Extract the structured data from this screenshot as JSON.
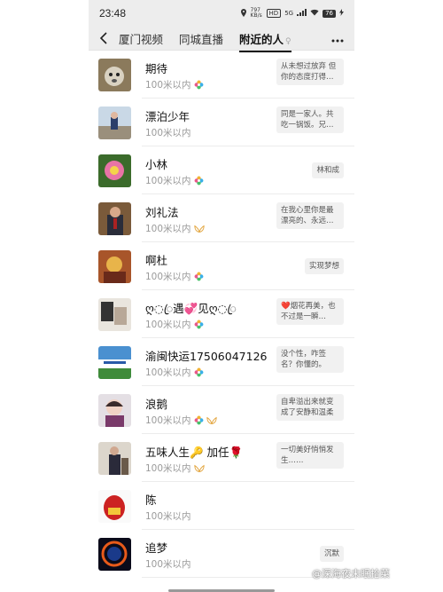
{
  "status": {
    "time": "23:48",
    "net_speed": "797 KB/s",
    "hd": "HD",
    "signal": "5G",
    "battery": "76"
  },
  "nav": {
    "tabs": [
      "厦门视频",
      "同城直播",
      "附近的人"
    ],
    "active_tab": 2,
    "filter_hint": "♀"
  },
  "users": [
    {
      "name": "期待",
      "distance": "100米以内",
      "badges": [
        "flower"
      ],
      "signature": "从未想过放弃 但你的态度打得…"
    },
    {
      "name": "漂泊少年",
      "distance": "100米以内",
      "badges": [],
      "signature": "同是一家人。共吃一锅饭。兄…"
    },
    {
      "name": "小林",
      "distance": "100米以内",
      "badges": [
        "flower"
      ],
      "signature": "林和成"
    },
    {
      "name": "刘礼法",
      "distance": "100米以内",
      "badges": [
        "wings"
      ],
      "signature": "在我心里你是最漂亮的、永远…"
    },
    {
      "name": "啊杜",
      "distance": "100米以内",
      "badges": [
        "flower"
      ],
      "signature": "实现梦想"
    },
    {
      "name": "ღ◌ꦿ遇💞见ღ◌ꦿ",
      "distance": "100米以内",
      "badges": [
        "flower"
      ],
      "signature": "❤️烟花再美，也不过是一瞬…"
    },
    {
      "name": "渝闽快运17506047126",
      "distance": "100米以内",
      "badges": [
        "flower"
      ],
      "signature": "没个性，咋签名？你懂的。"
    },
    {
      "name": "浪鹅",
      "distance": "100米以内",
      "badges": [
        "flower",
        "wings"
      ],
      "signature": "自卑溢出来就变成了安静和温柔"
    },
    {
      "name": "五味人生🔑 加任🌹",
      "distance": "100米以内",
      "badges": [
        "wings"
      ],
      "signature": "一切美好悄悄发生……"
    },
    {
      "name": "陈",
      "distance": "100米以内",
      "badges": [],
      "signature": ""
    },
    {
      "name": "追梦",
      "distance": "100米以内",
      "badges": [],
      "signature": "沉默"
    }
  ],
  "watermark": "@深海夜未眠拾菜",
  "colors": {
    "topbar_bg": "#ededed",
    "tab_indicator": "#111111",
    "signature_bg": "#f1f1f1",
    "distance_text": "#9a9a9a"
  }
}
